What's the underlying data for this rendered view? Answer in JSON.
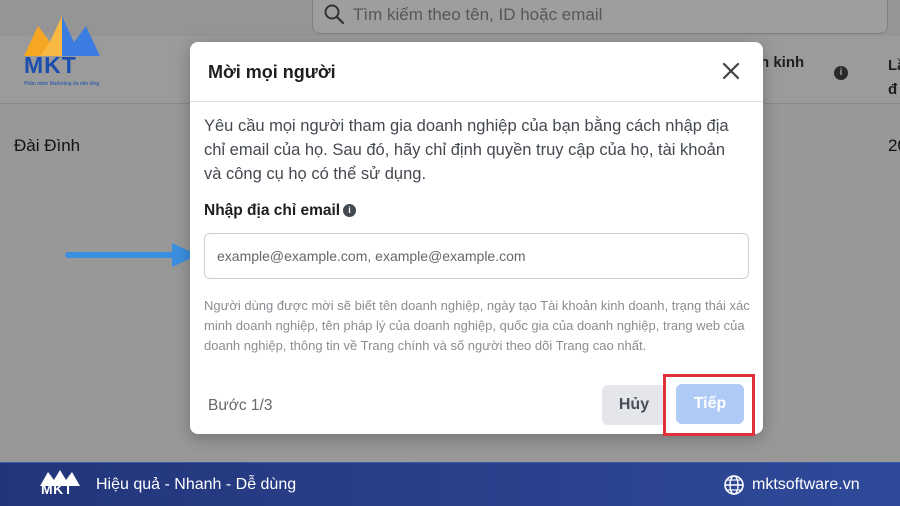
{
  "background": {
    "search_placeholder": "Tìm kiếm theo tên, ID hoặc email",
    "column_kinh": "h kinh",
    "column_la": "Lầ\nđ",
    "row_name": "Đài Đình",
    "row_value": "20"
  },
  "brand": {
    "logo_text": "MKT",
    "logo_tagline": "Phần mềm Marketing đa nền tảng"
  },
  "modal": {
    "title": "Mời mọi người",
    "description": "Yêu cầu mọi người tham gia doanh nghiệp của bạn bằng cách nhập địa chỉ email của họ. Sau đó, hãy chỉ định quyền truy cập của họ, tài khoản và công cụ họ có thể sử dụng.",
    "email_label": "Nhập địa chỉ email",
    "email_value": "",
    "email_placeholder": "example@example.com, example@example.com",
    "note": "Người dùng được mời sẽ biết tên doanh nghiệp, ngày tạo Tài khoản kinh doanh, trạng thái xác minh doanh nghiệp, tên pháp lý của doanh nghiệp, quốc gia của doanh nghiệp, trang web của doanh nghiệp, thông tin về Trang chính và số người theo dõi Trang cao nhất.",
    "step": "Bước 1/3",
    "cancel_label": "Hủy",
    "next_label": "Tiếp"
  },
  "footer": {
    "logo_text": "MKT",
    "slogan": "Hiệu quả - Nhanh - Dễ dùng",
    "website": "mktsoftware.vn"
  },
  "colors": {
    "footer_bg": "#2a3f86",
    "next_button": "#aecbf5",
    "highlight": "#e0313a",
    "arrow": "#3b8fe0",
    "brand_blue": "#1a4fb0",
    "brand_orange": "#f5a623"
  },
  "icons": [
    "search-icon",
    "info-icon",
    "close-icon",
    "arrow-pointer-icon",
    "globe-icon"
  ]
}
